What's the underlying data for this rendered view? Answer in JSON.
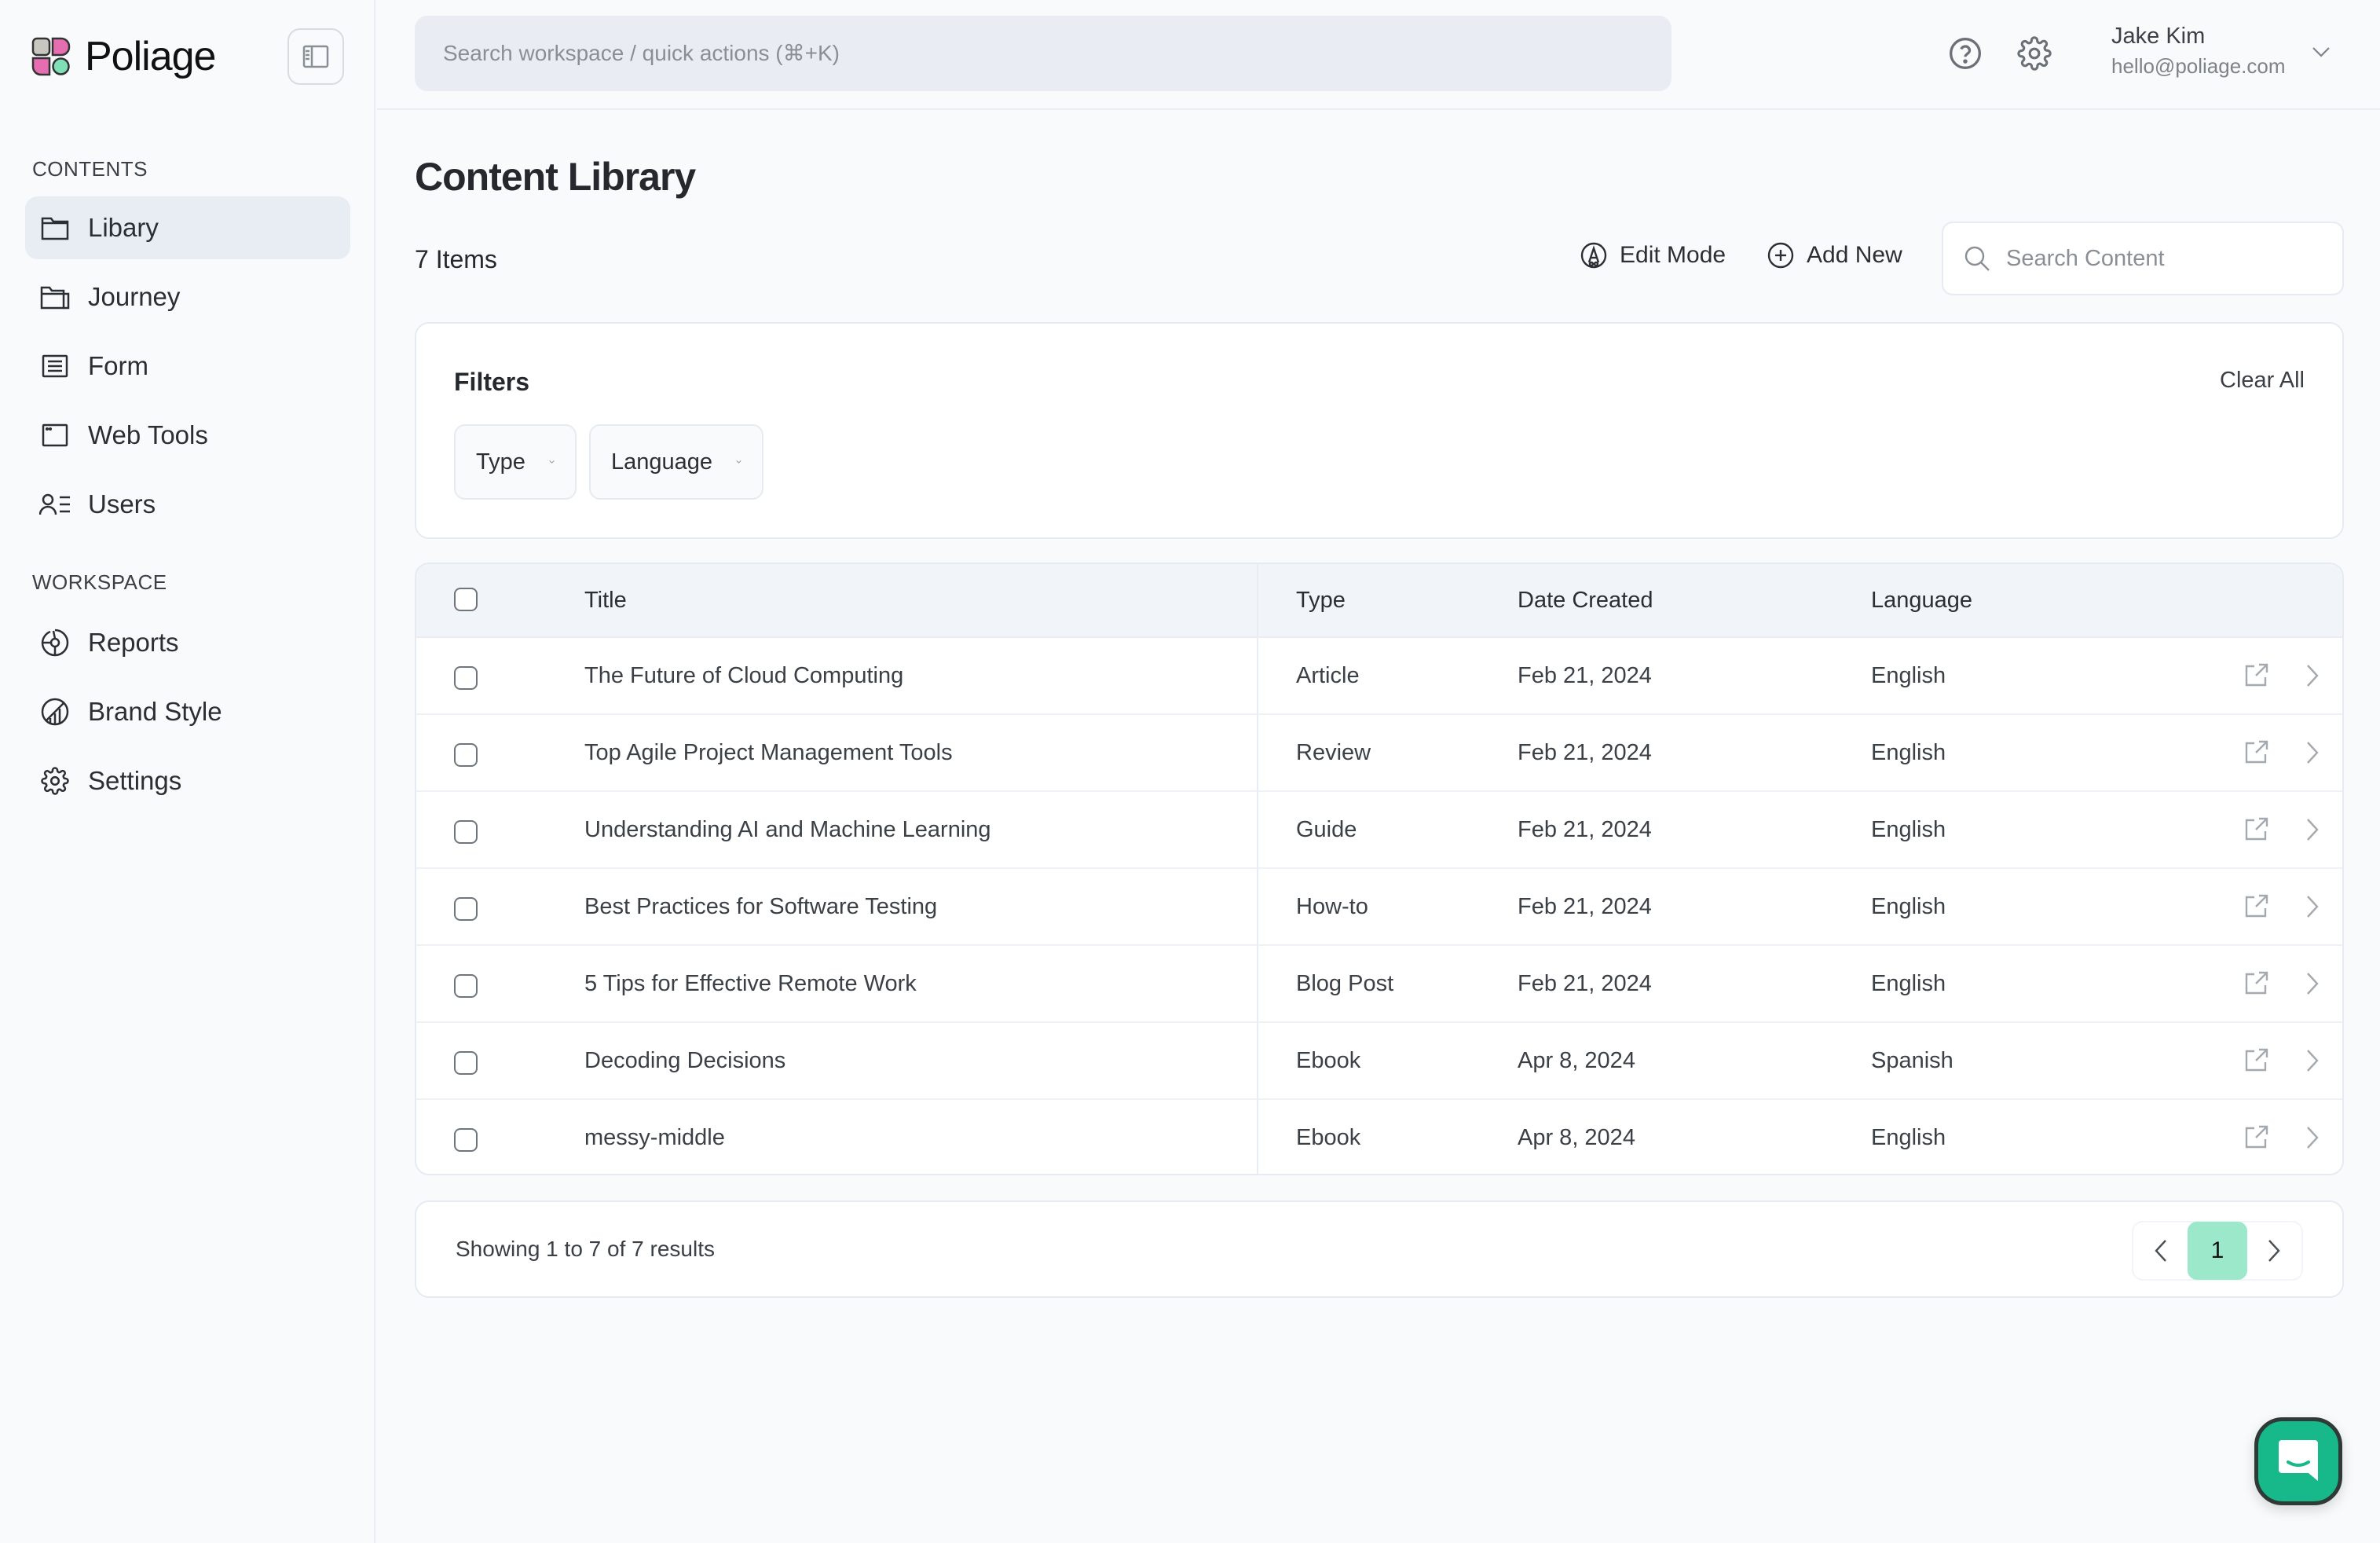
{
  "brand": {
    "name": "Poliage"
  },
  "sidebar": {
    "sections": [
      {
        "label": "CONTENTS",
        "items": [
          {
            "label": "Libary",
            "icon": "folder-icon",
            "active": true
          },
          {
            "label": "Journey",
            "icon": "folders-icon",
            "active": false
          },
          {
            "label": "Form",
            "icon": "form-icon",
            "active": false
          },
          {
            "label": "Web Tools",
            "icon": "browser-window-icon",
            "active": false
          },
          {
            "label": "Users",
            "icon": "user-list-icon",
            "active": false
          }
        ]
      },
      {
        "label": "WORKSPACE",
        "items": [
          {
            "label": "Reports",
            "icon": "pie-chart-icon",
            "active": false
          },
          {
            "label": "Brand Style",
            "icon": "brand-chart-icon",
            "active": false
          },
          {
            "label": "Settings",
            "icon": "gear-icon",
            "active": false
          }
        ]
      }
    ]
  },
  "header": {
    "search_placeholder": "Search workspace / quick actions (⌘+K)",
    "user": {
      "name": "Jake Kim",
      "email": "hello@poliage.com"
    }
  },
  "main": {
    "title": "Content Library",
    "items_count": "7 Items",
    "edit_mode_label": "Edit Mode",
    "add_new_label": "Add New",
    "search_placeholder": "Search Content",
    "filters": {
      "title": "Filters",
      "clear_all_label": "Clear All",
      "selects": [
        {
          "label": "Type"
        },
        {
          "label": "Language"
        }
      ]
    },
    "table": {
      "columns": [
        "Title",
        "Type",
        "Date Created",
        "Language"
      ],
      "rows": [
        {
          "title": "The Future of Cloud Computing",
          "type": "Article",
          "date": "Feb 21, 2024",
          "language": "English"
        },
        {
          "title": "Top Agile Project Management Tools",
          "type": "Review",
          "date": "Feb 21, 2024",
          "language": "English"
        },
        {
          "title": "Understanding AI and Machine Learning",
          "type": "Guide",
          "date": "Feb 21, 2024",
          "language": "English"
        },
        {
          "title": "Best Practices for Software Testing",
          "type": "How-to",
          "date": "Feb 21, 2024",
          "language": "English"
        },
        {
          "title": "5 Tips for Effective Remote Work",
          "type": "Blog Post",
          "date": "Feb 21, 2024",
          "language": "English"
        },
        {
          "title": "Decoding Decisions",
          "type": "Ebook",
          "date": "Apr 8, 2024",
          "language": "Spanish"
        },
        {
          "title": "messy-middle",
          "type": "Ebook",
          "date": "Apr 8, 2024",
          "language": "English"
        }
      ]
    },
    "pagination": {
      "summary": "Showing 1 to 7 of 7 results",
      "current_page": "1"
    }
  },
  "colors": {
    "accent": "#17b889",
    "page_active": "#9ce8ca",
    "logo_pink": "#e46eb0",
    "logo_gray": "#c8c6c0",
    "logo_green": "#7fe0b8"
  }
}
